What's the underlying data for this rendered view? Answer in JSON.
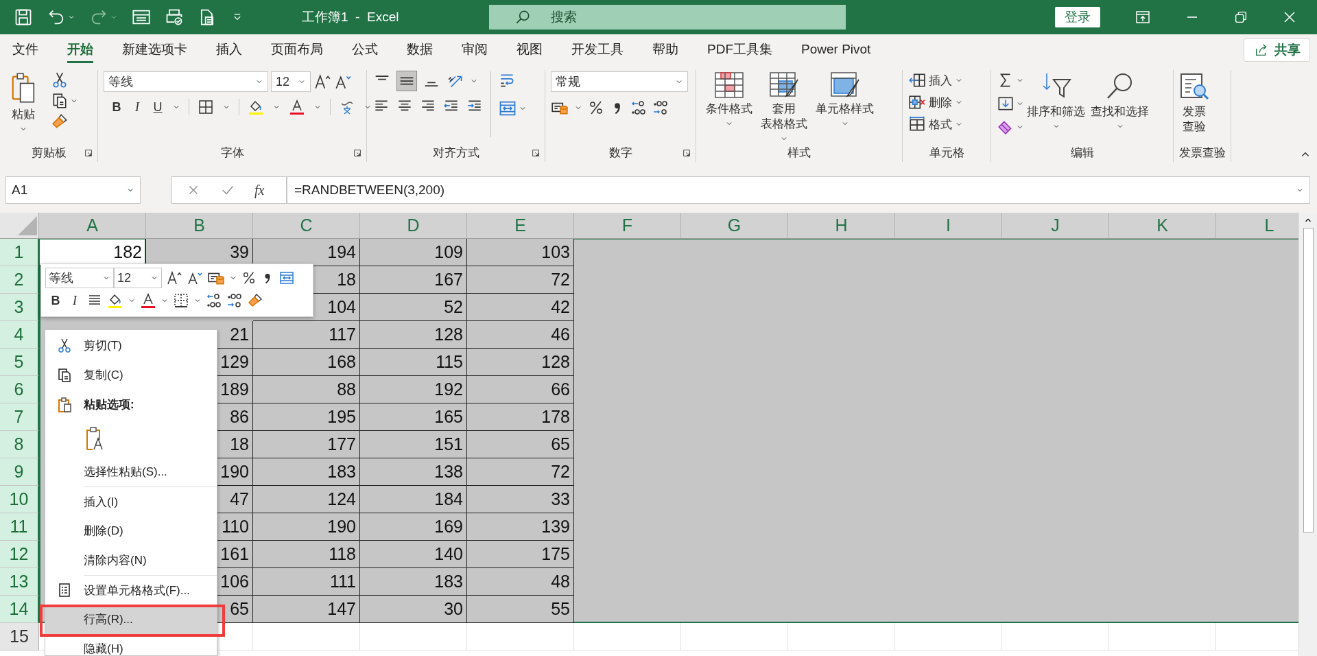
{
  "title_bar": {
    "title": "工作簿1  -  Excel",
    "search": {
      "placeholder": "搜索"
    },
    "sign_in": "登录"
  },
  "tabs": [
    {
      "label": "文件",
      "selected": false
    },
    {
      "label": "开始",
      "selected": true
    },
    {
      "label": "新建选项卡",
      "selected": false
    },
    {
      "label": "插入",
      "selected": false
    },
    {
      "label": "页面布局",
      "selected": false
    },
    {
      "label": "公式",
      "selected": false
    },
    {
      "label": "数据",
      "selected": false
    },
    {
      "label": "审阅",
      "selected": false
    },
    {
      "label": "视图",
      "selected": false
    },
    {
      "label": "开发工具",
      "selected": false
    },
    {
      "label": "帮助",
      "selected": false
    },
    {
      "label": "PDF工具集",
      "selected": false
    },
    {
      "label": "Power Pivot",
      "selected": false
    }
  ],
  "share_button": "共享",
  "ribbon_groups": [
    {
      "kind": "clipboard",
      "label": "剪贴板",
      "paste": "粘贴"
    },
    {
      "kind": "font",
      "label": "字体",
      "font_name": "等线",
      "font_size": "12",
      "bold": "B",
      "italic": "I",
      "underline": "U"
    },
    {
      "kind": "alignment",
      "label": "对齐方式",
      "vertical_align": [
        {
          "selected": false
        },
        {
          "selected": true
        },
        {
          "selected": false
        }
      ]
    },
    {
      "kind": "number",
      "label": "数字",
      "format": "常规"
    },
    {
      "kind": "styles",
      "label": "样式",
      "buttons": [
        {
          "kind": "conditional",
          "lines": [
            "条件格式"
          ]
        },
        {
          "kind": "table",
          "lines": [
            "套用",
            "表格格式"
          ]
        },
        {
          "kind": "cell-style",
          "lines": [
            "单元格样式"
          ]
        }
      ]
    },
    {
      "kind": "cells",
      "label": "单元格",
      "buttons": [
        {
          "kind": "insert",
          "label": "插入"
        },
        {
          "kind": "delete",
          "label": "删除"
        },
        {
          "kind": "format",
          "label": "格式"
        }
      ]
    },
    {
      "kind": "editing",
      "label": "编辑",
      "buttons": [
        {
          "kind": "sort",
          "label": "排序和筛选"
        },
        {
          "kind": "find",
          "label": "查找和选择"
        }
      ]
    },
    {
      "kind": "invoice",
      "label": "发票查验",
      "lines": [
        "发票",
        "查验"
      ]
    }
  ],
  "formula_bar": {
    "name_box": "A1",
    "function_label": "fx",
    "formula": "=RANDBETWEEN(3,200)"
  },
  "grid": {
    "columns": [
      "A",
      "B",
      "C",
      "D",
      "E",
      "F",
      "G",
      "H",
      "I",
      "J",
      "K",
      "L"
    ],
    "rows": [
      {
        "header": "1",
        "selected": true,
        "cells": [
          {
            "value": "182",
            "active": true
          },
          {
            "value": "39",
            "active": false
          },
          {
            "value": "194",
            "active": false
          },
          {
            "value": "109",
            "active": false
          },
          {
            "value": "103",
            "active": false
          }
        ]
      },
      {
        "header": "2",
        "selected": true,
        "cells": [
          null,
          null,
          "18",
          "167",
          "72"
        ]
      },
      {
        "header": "3",
        "selected": true,
        "cells": [
          null,
          null,
          "104",
          "52",
          "42"
        ]
      },
      {
        "header": "4",
        "selected": true,
        "cells": [
          null,
          "21",
          "117",
          "128",
          "46"
        ]
      },
      {
        "header": "5",
        "selected": true,
        "cells": [
          null,
          "129",
          "168",
          "115",
          "128"
        ]
      },
      {
        "header": "6",
        "selected": true,
        "cells": [
          null,
          "189",
          "88",
          "192",
          "66"
        ]
      },
      {
        "header": "7",
        "selected": true,
        "cells": [
          null,
          "86",
          "195",
          "165",
          "178"
        ]
      },
      {
        "header": "8",
        "selected": true,
        "cells": [
          null,
          "18",
          "177",
          "151",
          "65"
        ]
      },
      {
        "header": "9",
        "selected": true,
        "cells": [
          null,
          "190",
          "183",
          "138",
          "72"
        ]
      },
      {
        "header": "10",
        "selected": true,
        "cells": [
          null,
          "47",
          "124",
          "184",
          "33"
        ]
      },
      {
        "header": "11",
        "selected": true,
        "cells": [
          null,
          "110",
          "190",
          "169",
          "139"
        ]
      },
      {
        "header": "12",
        "selected": true,
        "cells": [
          null,
          "161",
          "118",
          "140",
          "175"
        ]
      },
      {
        "header": "13",
        "selected": true,
        "cells": [
          null,
          "106",
          "111",
          "183",
          "48"
        ]
      },
      {
        "header": "14",
        "selected": true,
        "cells": [
          null,
          "65",
          "147",
          "30",
          "55"
        ]
      },
      {
        "header": "15",
        "selected": false
      }
    ]
  },
  "mini_toolbar": {
    "font_name": "等线",
    "font_size": "12",
    "bold": "B",
    "italic": "I"
  },
  "context_menu": [
    {
      "kind": "cut",
      "label": "剪切(T)",
      "selected": false,
      "boxed": false,
      "divider_above": false
    },
    {
      "kind": "copy",
      "label": "复制(C)",
      "selected": false,
      "boxed": false,
      "divider_above": false
    },
    {
      "kind": "paste-heading",
      "label": "粘贴选项:",
      "selected": false,
      "boxed": false,
      "divider_above": false
    },
    {
      "kind": "paste-option",
      "selected": false,
      "boxed": false,
      "divider_above": false
    },
    {
      "kind": "command",
      "label": "选择性粘贴(S)...",
      "selected": false,
      "boxed": false,
      "divider_above": false
    },
    {
      "kind": "command",
      "label": "插入(I)",
      "selected": false,
      "boxed": false,
      "divider_above": true
    },
    {
      "kind": "command",
      "label": "删除(D)",
      "selected": false,
      "boxed": false,
      "divider_above": false
    },
    {
      "kind": "command",
      "label": "清除内容(N)",
      "selected": false,
      "boxed": false,
      "divider_above": false
    },
    {
      "kind": "format-cells",
      "label": "设置单元格格式(F)...",
      "selected": false,
      "boxed": false,
      "divider_above": true
    },
    {
      "kind": "command",
      "label": "行高(R)...",
      "selected": true,
      "boxed": true,
      "divider_above": false
    },
    {
      "kind": "command",
      "label": "隐藏(H)",
      "selected": false,
      "boxed": false,
      "divider_above": false
    }
  ]
}
